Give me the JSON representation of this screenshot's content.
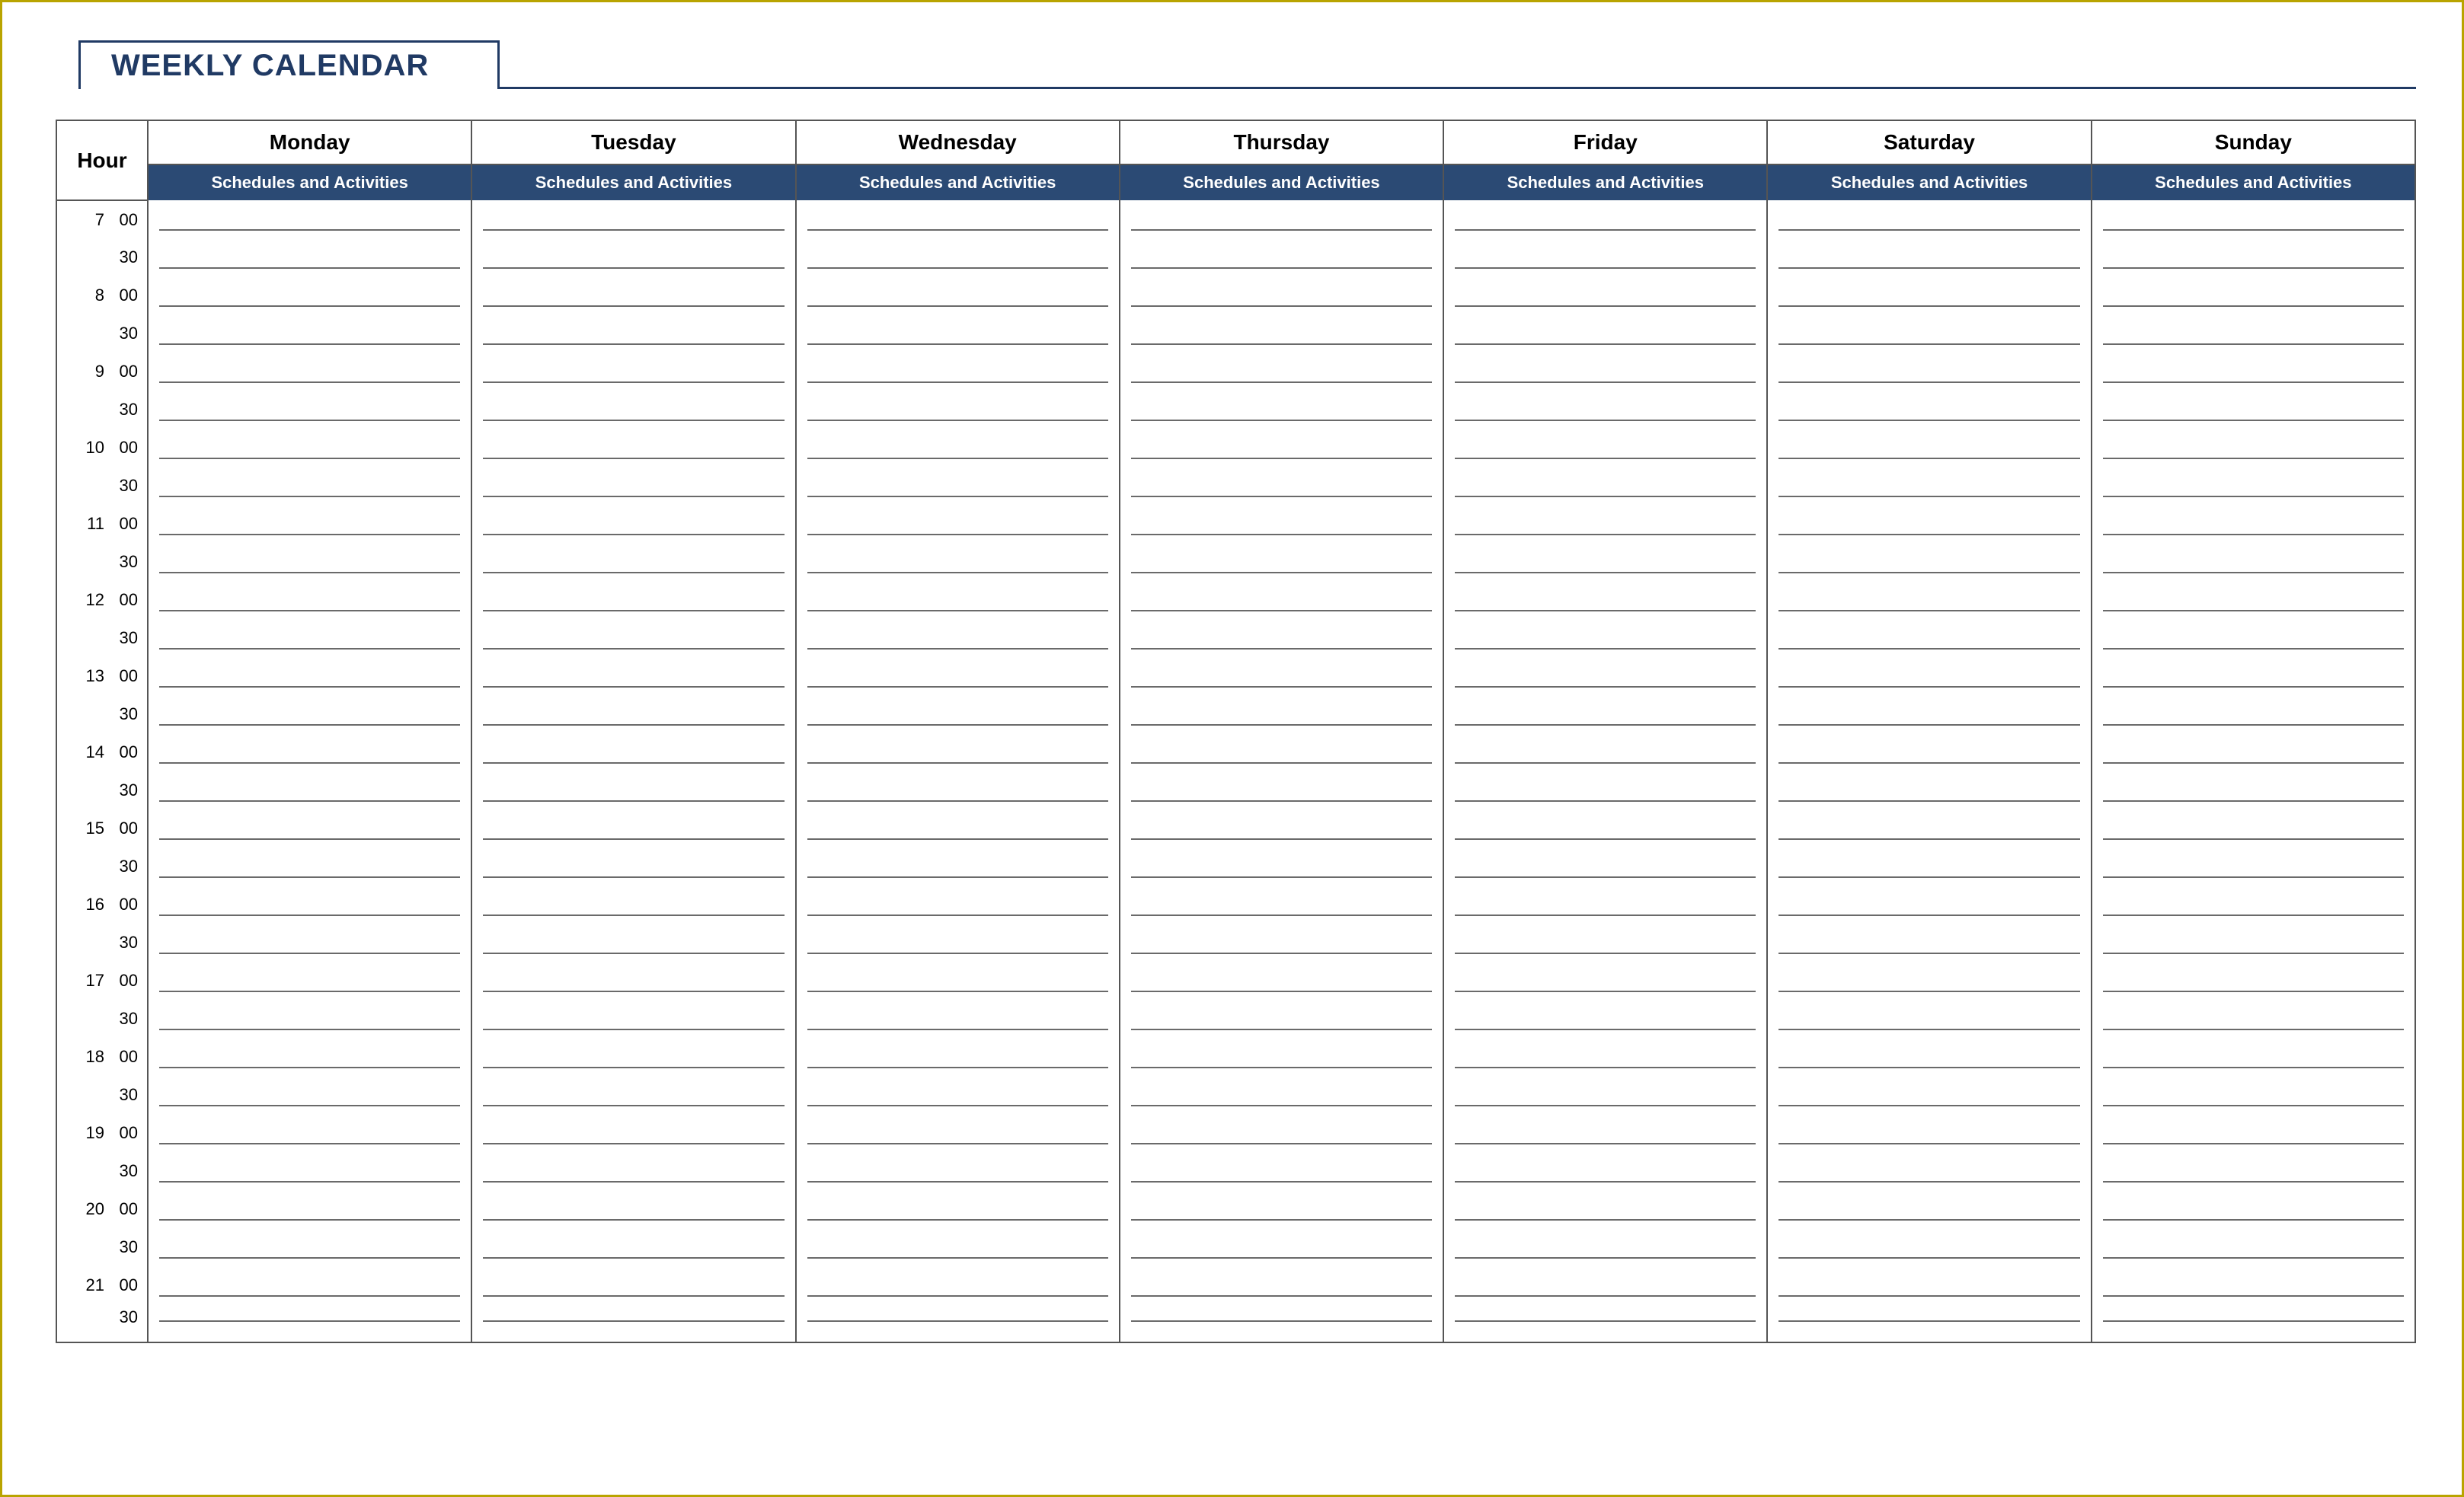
{
  "title": "WEEKLY CALENDAR",
  "hour_header": "Hour",
  "sub_header": "Schedules and Activities",
  "days": [
    "Monday",
    "Tuesday",
    "Wednesday",
    "Thursday",
    "Friday",
    "Saturday",
    "Sunday"
  ],
  "timeslots": [
    {
      "hour": "7",
      "minute": "00"
    },
    {
      "hour": "",
      "minute": "30"
    },
    {
      "hour": "8",
      "minute": "00"
    },
    {
      "hour": "",
      "minute": "30"
    },
    {
      "hour": "9",
      "minute": "00"
    },
    {
      "hour": "",
      "minute": "30"
    },
    {
      "hour": "10",
      "minute": "00"
    },
    {
      "hour": "",
      "minute": "30"
    },
    {
      "hour": "11",
      "minute": "00"
    },
    {
      "hour": "",
      "minute": "30"
    },
    {
      "hour": "12",
      "minute": "00"
    },
    {
      "hour": "",
      "minute": "30"
    },
    {
      "hour": "13",
      "minute": "00"
    },
    {
      "hour": "",
      "minute": "30"
    },
    {
      "hour": "14",
      "minute": "00"
    },
    {
      "hour": "",
      "minute": "30"
    },
    {
      "hour": "15",
      "minute": "00"
    },
    {
      "hour": "",
      "minute": "30"
    },
    {
      "hour": "16",
      "minute": "00"
    },
    {
      "hour": "",
      "minute": "30"
    },
    {
      "hour": "17",
      "minute": "00"
    },
    {
      "hour": "",
      "minute": "30"
    },
    {
      "hour": "18",
      "minute": "00"
    },
    {
      "hour": "",
      "minute": "30"
    },
    {
      "hour": "19",
      "minute": "00"
    },
    {
      "hour": "",
      "minute": "30"
    },
    {
      "hour": "20",
      "minute": "00"
    },
    {
      "hour": "",
      "minute": "30"
    },
    {
      "hour": "21",
      "minute": "00"
    },
    {
      "hour": "",
      "minute": "30"
    }
  ],
  "colors": {
    "frame": "#b9a400",
    "accent": "#203a64",
    "subheader_bg": "#2b4a74"
  }
}
